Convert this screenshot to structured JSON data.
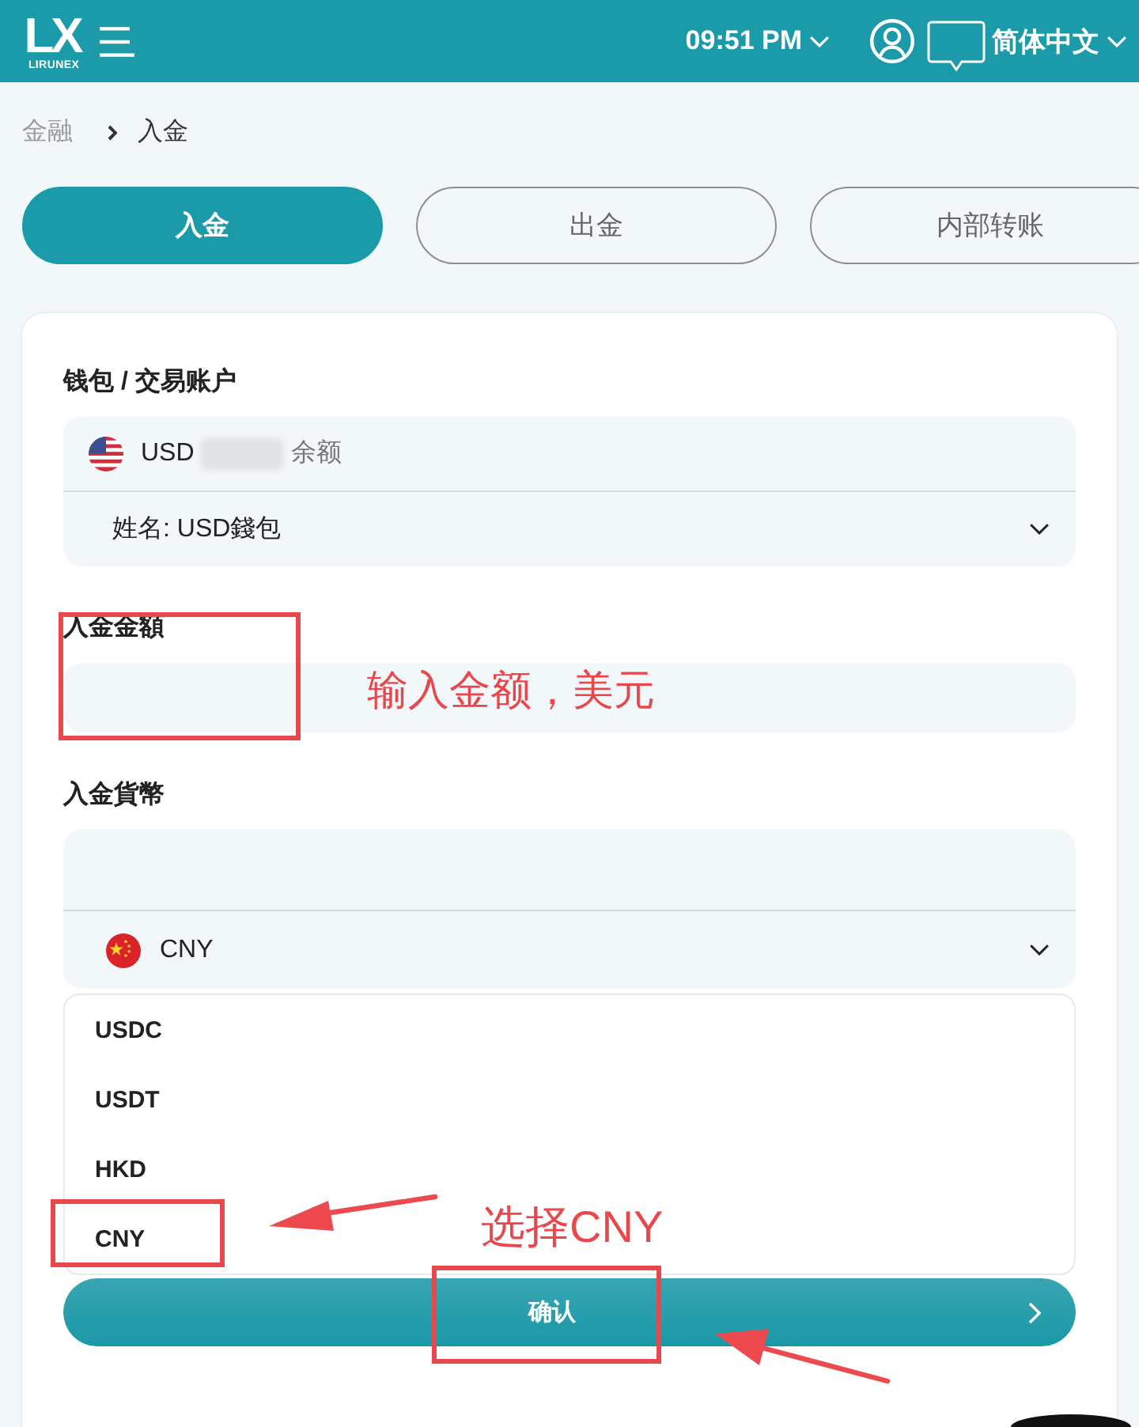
{
  "header": {
    "logo": {
      "mark": "LX",
      "wordmark": "LIRUNEX"
    },
    "time": "09:51 PM",
    "language": "简体中文"
  },
  "breadcrumb": [
    {
      "label": "金融",
      "current": false
    },
    {
      "label": "入金",
      "current": true
    }
  ],
  "tabs": [
    {
      "label": "入金",
      "selected": true
    },
    {
      "label": "出金",
      "selected": false
    },
    {
      "label": "内部转账",
      "selected": false
    }
  ],
  "form": {
    "wallet": {
      "label": "钱包 / 交易账户",
      "currency": "USD",
      "balance_hidden": true,
      "balance_label": "余额",
      "account": "姓名: USD錢包"
    },
    "amount": {
      "label": "入金金額",
      "highlighted": true,
      "note": "输入金额，美元"
    },
    "deposit_currency": {
      "label": "入金貨幣",
      "value": "CNY",
      "expanded": true,
      "options": [
        {
          "label": "USDC",
          "highlighted": false
        },
        {
          "label": "USDT",
          "highlighted": false
        },
        {
          "label": "HKD",
          "highlighted": false
        },
        {
          "label": "CNY",
          "highlighted": true,
          "note": "选择CNY"
        }
      ]
    },
    "submit": {
      "label": "确认",
      "highlighted": true
    }
  }
}
